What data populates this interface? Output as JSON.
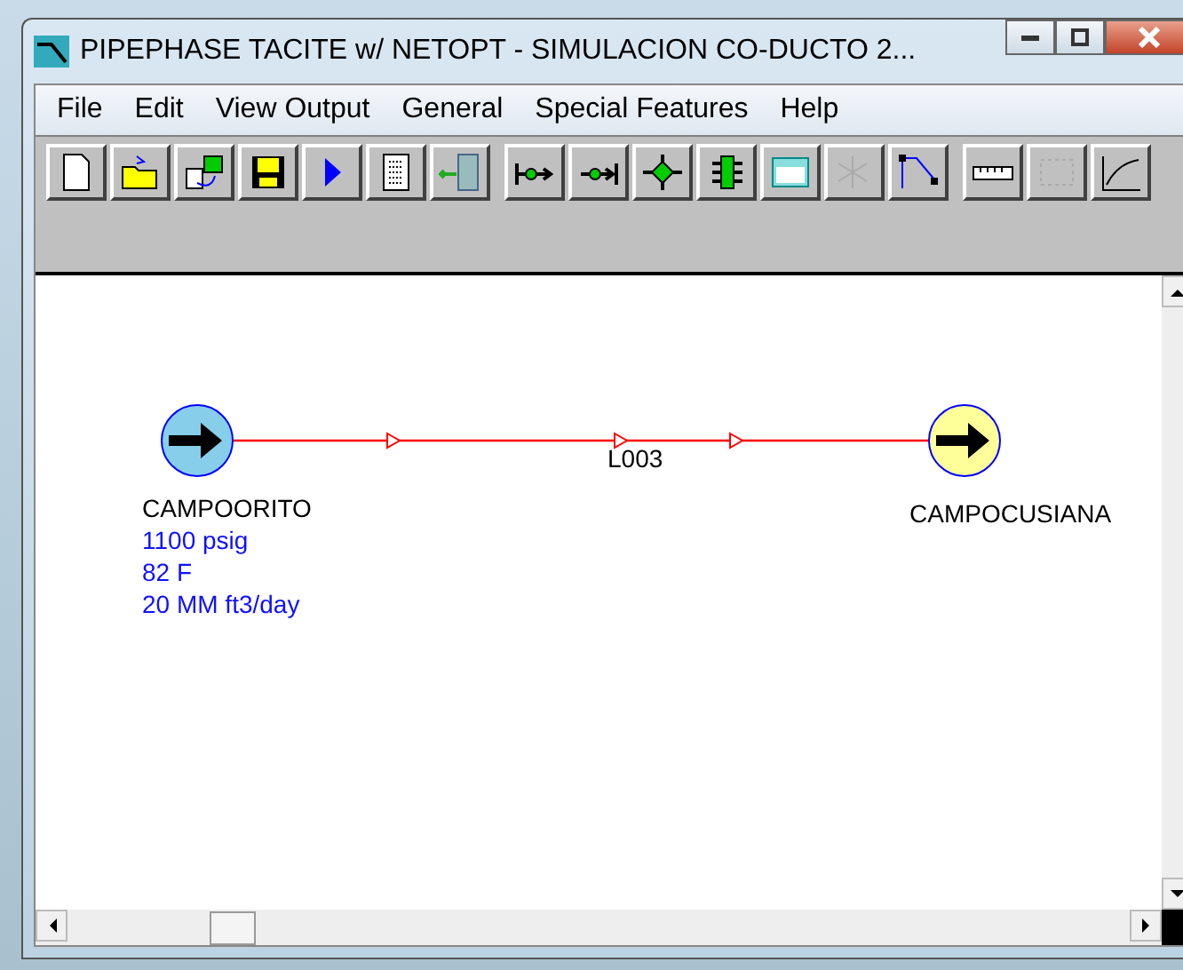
{
  "window": {
    "title": "PIPEPHASE TACITE w/ NETOPT - SIMULACION CO-DUCTO 2..."
  },
  "menu": [
    "File",
    "Edit",
    "View Output",
    "General",
    "Special Features",
    "Help"
  ],
  "toolbar_groups": [
    [
      {
        "kind": "new",
        "disabled": false
      },
      {
        "kind": "open",
        "disabled": false
      },
      {
        "kind": "import",
        "disabled": false
      },
      {
        "kind": "save",
        "disabled": false
      },
      {
        "kind": "run",
        "disabled": false
      },
      {
        "kind": "report",
        "disabled": false
      },
      {
        "kind": "exit",
        "disabled": false
      }
    ],
    [
      {
        "kind": "source",
        "disabled": false
      },
      {
        "kind": "sink",
        "disabled": false
      },
      {
        "kind": "junction",
        "disabled": false
      },
      {
        "kind": "device",
        "disabled": false
      },
      {
        "kind": "calculator",
        "disabled": false
      },
      {
        "kind": "snowflake",
        "disabled": true
      },
      {
        "kind": "polyline",
        "disabled": false
      }
    ],
    [
      {
        "kind": "ruler",
        "disabled": false
      },
      {
        "kind": "grid",
        "disabled": true
      },
      {
        "kind": "chart",
        "disabled": false
      }
    ]
  ],
  "canvas": {
    "nodes": [
      {
        "kind": "source",
        "name": "CAMPOORITO",
        "color": "#87ceeb",
        "details": [
          "1100 psig",
          "82 F",
          "20 MM ft3/day"
        ]
      },
      {
        "kind": "sink",
        "name": "CAMPOCUSIANA",
        "color": "#ffff99"
      }
    ],
    "links": [
      {
        "name": "L003"
      }
    ]
  }
}
